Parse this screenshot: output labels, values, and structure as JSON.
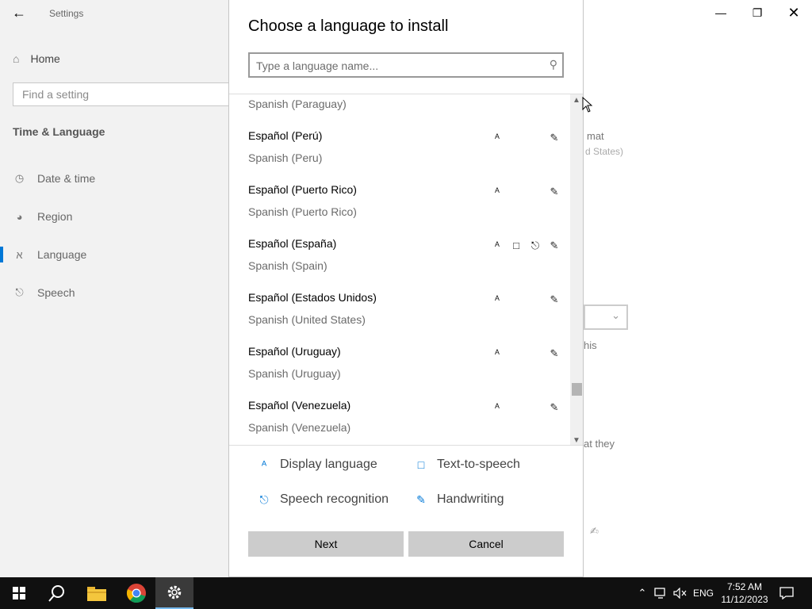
{
  "settings": {
    "title": "Settings",
    "home_label": "Home",
    "search_placeholder": "Find a setting",
    "section_title": "Time & Language",
    "nav_items": [
      {
        "label": "Date & time",
        "icon": "calendar-clock-icon"
      },
      {
        "label": "Region",
        "icon": "globe-icon"
      },
      {
        "label": "Language",
        "icon": "language-icon"
      },
      {
        "label": "Speech",
        "icon": "microphone-icon"
      }
    ],
    "active_item": "Language",
    "background_fragments": [
      "mat",
      "d States)",
      "his",
      "at they"
    ]
  },
  "dialog": {
    "title": "Choose a language to install",
    "search_placeholder": "Type a language name...",
    "partial_item_english": "Spanish (Paraguay)",
    "languages": [
      {
        "native": "Español (Perú)",
        "english": "Spanish (Peru)",
        "features": [
          "display-language",
          "handwriting"
        ]
      },
      {
        "native": "Español (Puerto Rico)",
        "english": "Spanish (Puerto Rico)",
        "features": [
          "display-language",
          "handwriting"
        ]
      },
      {
        "native": "Español (España)",
        "english": "Spanish (Spain)",
        "features": [
          "display-language",
          "text-to-speech",
          "speech-recognition",
          "handwriting"
        ]
      },
      {
        "native": "Español (Estados Unidos)",
        "english": "Spanish (United States)",
        "features": [
          "display-language",
          "handwriting"
        ]
      },
      {
        "native": "Español (Uruguay)",
        "english": "Spanish (Uruguay)",
        "features": [
          "display-language",
          "handwriting"
        ]
      },
      {
        "native": "Español (Venezuela)",
        "english": "Spanish (Venezuela)",
        "features": [
          "display-language",
          "handwriting"
        ]
      }
    ],
    "legend": [
      {
        "label": "Display language",
        "icon": "display-language-icon"
      },
      {
        "label": "Text-to-speech",
        "icon": "text-to-speech-icon"
      },
      {
        "label": "Speech recognition",
        "icon": "speech-recognition-icon"
      },
      {
        "label": "Handwriting",
        "icon": "handwriting-icon"
      }
    ],
    "next_label": "Next",
    "cancel_label": "Cancel"
  },
  "taskbar": {
    "language": "ENG",
    "time": "7:52 AM",
    "date": "11/12/2023",
    "apps": [
      "start-icon",
      "search-icon",
      "file-explorer-icon",
      "chrome-icon",
      "settings-icon"
    ]
  },
  "colors": {
    "accent": "#0078d7",
    "taskbar": "#101010",
    "button": "#cccccc"
  }
}
